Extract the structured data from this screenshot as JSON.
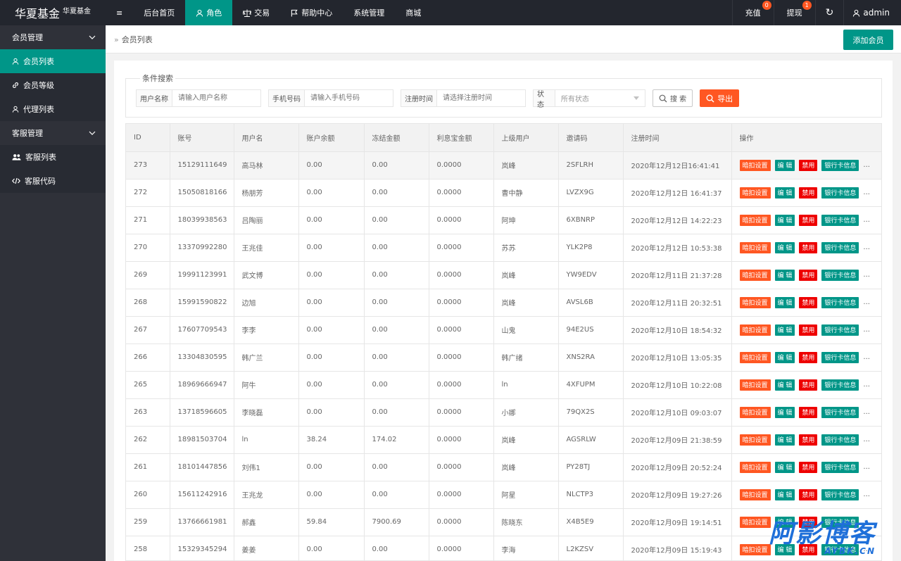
{
  "logo": {
    "main": "华夏基金",
    "sub": "华夏基金"
  },
  "nav": [
    {
      "label": "≡",
      "icon": "menu-icon"
    },
    {
      "label": "后台首页"
    },
    {
      "label": "角色",
      "icon": "user-icon",
      "active": true
    },
    {
      "label": "交易",
      "icon": "scale-icon"
    },
    {
      "label": "帮助中心",
      "icon": "flag-icon"
    },
    {
      "label": "系统管理"
    },
    {
      "label": "商城"
    }
  ],
  "nav_right": {
    "recharge": "充值",
    "recharge_badge": "0",
    "withdraw": "提现",
    "withdraw_badge": "1",
    "refresh_icon": "↻",
    "user": "admin"
  },
  "sidebar": {
    "group1": "会员管理",
    "items1": [
      "会员列表",
      "会员等级",
      "代理列表"
    ],
    "group2": "客服管理",
    "items2": [
      "客服列表",
      "客服代码"
    ]
  },
  "breadcrumb": {
    "sep": "»",
    "current": "会员列表"
  },
  "add_button": "添加会员",
  "search": {
    "legend": "条件搜索",
    "username_label": "用户名称",
    "username_placeholder": "请输入用户名称",
    "phone_label": "手机号码",
    "phone_placeholder": "请输入手机号码",
    "regtime_label": "注册时间",
    "regtime_placeholder": "请选择注册时间",
    "status_label": "状态",
    "status_value": "所有状态",
    "search_btn": "搜 索",
    "export_btn": "导出"
  },
  "table": {
    "headers": [
      "ID",
      "账号",
      "用户名",
      "账户余额",
      "冻结金额",
      "利息宝金额",
      "上级用户",
      "邀请码",
      "注册时间",
      "操作"
    ],
    "ops": {
      "deduct": "暗扣设置",
      "edit": "编 辑",
      "disable": "禁用",
      "bank": "银行卡信息",
      "more": "..."
    },
    "rows": [
      [
        "273",
        "15129111649",
        "高马林",
        "0.00",
        "0.00",
        "0.0000",
        "岚峰",
        "2SFLRH",
        "2020年12月12日16:41:41"
      ],
      [
        "272",
        "15050818166",
        "杨朋芳",
        "0.00",
        "0.00",
        "0.0000",
        "曹中静",
        "LVZX9G",
        "2020年12月12日 16:41:37"
      ],
      [
        "271",
        "18039938563",
        "吕陶丽",
        "0.00",
        "0.00",
        "0.0000",
        "阿坤",
        "6XBNRP",
        "2020年12月12日 14:22:23"
      ],
      [
        "270",
        "13370992280",
        "王兆佳",
        "0.00",
        "0.00",
        "0.0000",
        "苏苏",
        "YLK2P8",
        "2020年12月12日 10:53:38"
      ],
      [
        "269",
        "19991123991",
        "武文博",
        "0.00",
        "0.00",
        "0.0000",
        "岚峰",
        "YW9EDV",
        "2020年12月11日 21:37:28"
      ],
      [
        "268",
        "15991590822",
        "边旭",
        "0.00",
        "0.00",
        "0.0000",
        "岚峰",
        "AVSL6B",
        "2020年12月11日 20:32:51"
      ],
      [
        "267",
        "17607709543",
        "李李",
        "0.00",
        "0.00",
        "0.0000",
        "山鬼",
        "94E2US",
        "2020年12月10日 18:54:32"
      ],
      [
        "266",
        "13304830595",
        "韩广兰",
        "0.00",
        "0.00",
        "0.0000",
        "韩广绪",
        "XNS2RA",
        "2020年12月10日 13:05:35"
      ],
      [
        "265",
        "18969666947",
        "阿牛",
        "0.00",
        "0.00",
        "0.0000",
        "ln",
        "4XFUPM",
        "2020年12月10日 10:22:08"
      ],
      [
        "263",
        "13718596605",
        "李晓磊",
        "0.00",
        "0.00",
        "0.0000",
        "小娜",
        "79QX2S",
        "2020年12月10日 09:03:07"
      ],
      [
        "262",
        "18981503704",
        "ln",
        "38.24",
        "174.02",
        "0.0000",
        "岚峰",
        "AGSRLW",
        "2020年12月09日 21:38:59"
      ],
      [
        "261",
        "18101447856",
        "刘伟1",
        "0.00",
        "0.00",
        "0.0000",
        "岚峰",
        "PY28TJ",
        "2020年12月09日 20:52:24"
      ],
      [
        "260",
        "15611242916",
        "王兆龙",
        "0.00",
        "0.00",
        "0.0000",
        "阿星",
        "NLCTP3",
        "2020年12月09日 19:27:26"
      ],
      [
        "259",
        "13766661981",
        "郝鑫",
        "59.84",
        "7900.69",
        "0.0000",
        "陈晓东",
        "X4B5E9",
        "2020年12月09日 19:14:51"
      ],
      [
        "258",
        "15329345294",
        "姜姜",
        "0.00",
        "0.00",
        "0.0000",
        "李海",
        "L2KZSV",
        "2020年12月09日 15:19:43"
      ]
    ]
  },
  "watermark": {
    "cn": "阿影博客",
    "en": "AYBK.CN"
  },
  "colors": {
    "accent": "#009688",
    "orange": "#ff5722",
    "red": "#ee0000",
    "topbar": "#23262e",
    "sidebar": "#2f3139"
  }
}
